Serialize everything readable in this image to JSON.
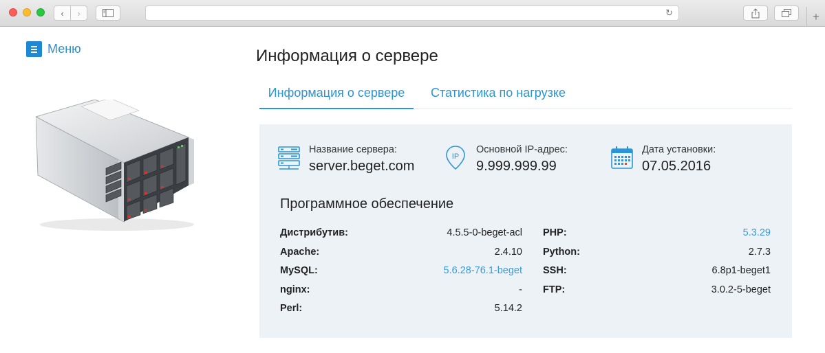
{
  "menu": {
    "label": "Меню"
  },
  "page": {
    "title": "Информация о сервере"
  },
  "tabs": [
    {
      "label": "Информация о сервере",
      "active": true
    },
    {
      "label": "Статистика по нагрузке",
      "active": false
    }
  ],
  "info": {
    "server_name": {
      "label": "Название сервера:",
      "value": "server.beget.com",
      "icon": "server-icon"
    },
    "ip": {
      "label": "Основной IP-адрес:",
      "value": "9.999.999.99",
      "icon": "ip-pin-icon"
    },
    "install_date": {
      "label": "Дата установки:",
      "value": "07.05.2016",
      "icon": "calendar-icon"
    }
  },
  "software": {
    "title": "Программное обеспечение",
    "left": [
      {
        "key": "Дистрибутив:",
        "value": "4.5.5-0-beget-acl",
        "link": false
      },
      {
        "key": "Apache:",
        "value": "2.4.10",
        "link": false
      },
      {
        "key": "MySQL:",
        "value": "5.6.28-76.1-beget",
        "link": true
      },
      {
        "key": "nginx:",
        "value": "-",
        "link": false
      },
      {
        "key": "Perl:",
        "value": "5.14.2",
        "link": false
      }
    ],
    "right": [
      {
        "key": "PHP:",
        "value": "5.3.29",
        "link": true
      },
      {
        "key": "Python:",
        "value": "2.7.3",
        "link": false
      },
      {
        "key": "SSH:",
        "value": "6.8p1-beget1",
        "link": false
      },
      {
        "key": "FTP:",
        "value": "3.0.2-5-beget",
        "link": false
      }
    ]
  },
  "colors": {
    "accent": "#2b95d6",
    "panel_bg": "#edf2f6",
    "link": "#3a9ad9"
  }
}
